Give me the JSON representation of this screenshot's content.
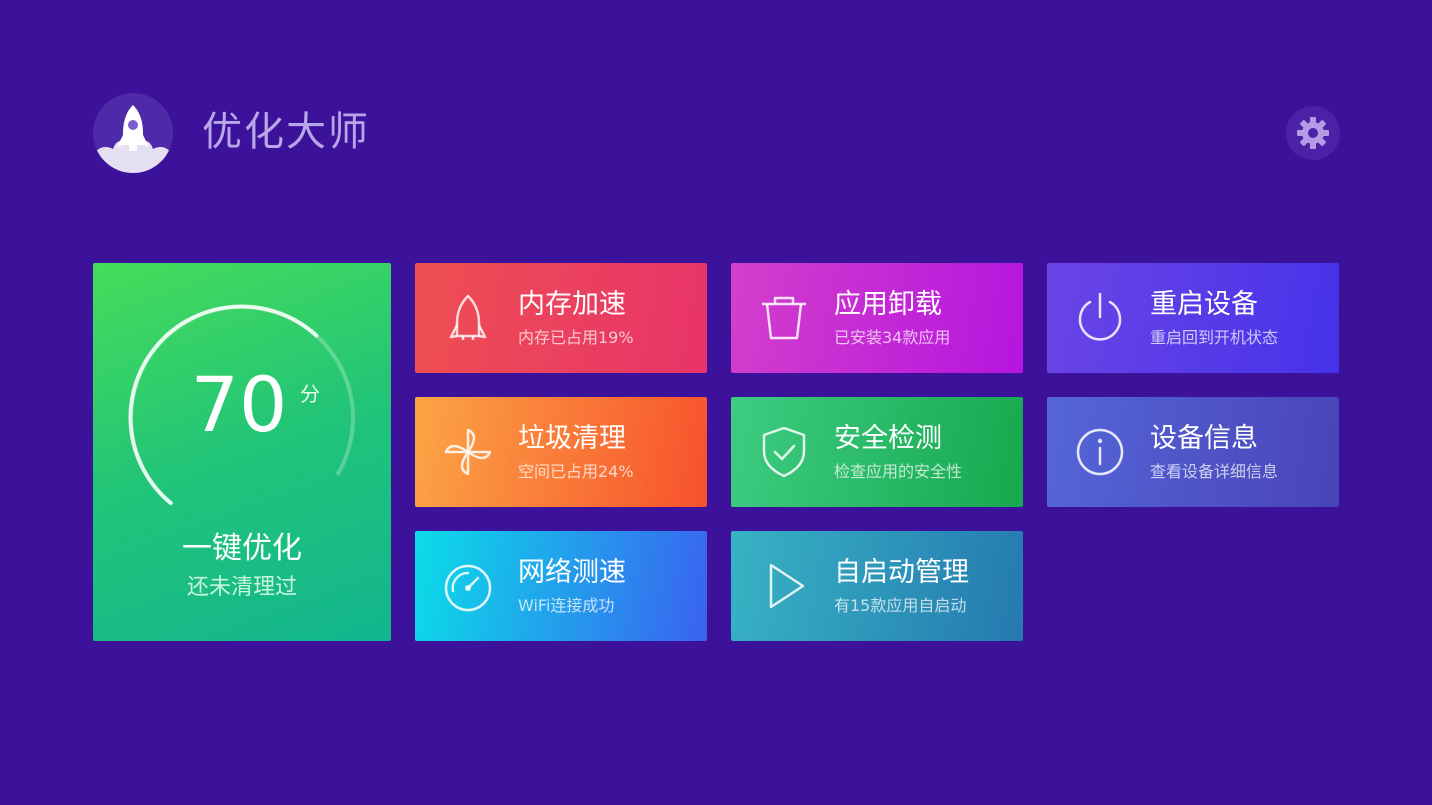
{
  "header": {
    "app_title": "优化大师",
    "logo_icon": "rocket-icon",
    "settings_icon": "gear-icon"
  },
  "score_tile": {
    "score": "70",
    "unit": "分",
    "gauge_level": 0.7,
    "action_label": "一键优化",
    "status_text": "还未清理过"
  },
  "tiles": [
    {
      "id": "memory",
      "icon": "rocket-icon",
      "title": "内存加速",
      "subtitle": "内存已占用19%",
      "color": "#ea4160"
    },
    {
      "id": "junk",
      "icon": "pinwheel-icon",
      "title": "垃圾清理",
      "subtitle": "空间已占用24%",
      "color": "#fa7a3a"
    },
    {
      "id": "network",
      "icon": "speedometer-icon",
      "title": "网络测速",
      "subtitle": "WiFi连接成功",
      "color": "#23a0ec"
    },
    {
      "id": "uninstall",
      "icon": "trash-icon",
      "title": "应用卸载",
      "subtitle": "已安装34款应用",
      "color": "#c42ad5"
    },
    {
      "id": "security",
      "icon": "shield-check-icon",
      "title": "安全检测",
      "subtitle": "检查应用的安全性",
      "color": "#2bba68"
    },
    {
      "id": "autostart",
      "icon": "play-icon",
      "title": "自启动管理",
      "subtitle": "有15款应用自启动",
      "color": "#2e96ba"
    },
    {
      "id": "reboot",
      "icon": "power-icon",
      "title": "重启设备",
      "subtitle": "重启回到开机状态",
      "color": "#583ce8"
    },
    {
      "id": "device_info",
      "icon": "info-icon",
      "title": "设备信息",
      "subtitle": "查看设备详细信息",
      "color": "#4f55c8"
    }
  ],
  "colors": {
    "background": "#3d129a",
    "header_text": "#b7a6e8"
  }
}
